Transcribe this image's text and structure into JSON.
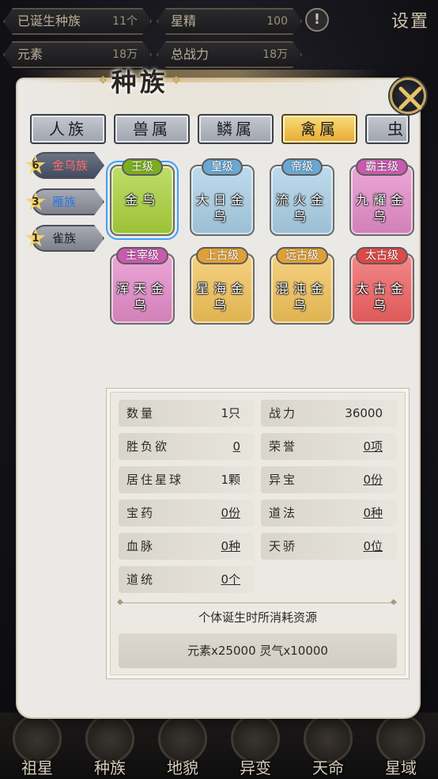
{
  "hud": {
    "born_species": {
      "label": "已诞生种族",
      "value": "11个"
    },
    "star_essence": {
      "label": "星精",
      "value": "100"
    },
    "elements": {
      "label": "元素",
      "value": "18万"
    },
    "total_power": {
      "label": "总战力",
      "value": "18万"
    },
    "settings_label": "设置"
  },
  "panel": {
    "title": "种族",
    "tabs": [
      {
        "label": "人族",
        "active": false
      },
      {
        "label": "兽属",
        "active": false
      },
      {
        "label": "鳞属",
        "active": false
      },
      {
        "label": "禽属",
        "active": true
      },
      {
        "label": "虫属",
        "active": false
      }
    ],
    "subtabs": [
      {
        "count": "6",
        "label": "金乌族",
        "active": true
      },
      {
        "count": "3",
        "label": "雁族",
        "active": false
      },
      {
        "count": "1",
        "label": "雀族",
        "active": false
      }
    ],
    "cards": [
      {
        "grade": "王级",
        "name": "金乌",
        "color": "#a9d23a",
        "badge_color": "#7cae22",
        "selected": true
      },
      {
        "grade": "皇级",
        "name": "大日金乌",
        "color": "#a9cfe6",
        "badge_color": "#6aa7d2",
        "selected": false
      },
      {
        "grade": "帝级",
        "name": "流火金乌",
        "color": "#a9cfe6",
        "badge_color": "#6aa7d2",
        "selected": false
      },
      {
        "grade": "霸主级",
        "name": "九耀金乌",
        "color": "#e48ac8",
        "badge_color": "#c95ab0",
        "selected": false
      },
      {
        "grade": "主宰级",
        "name": "浑天金乌",
        "color": "#e48ac8",
        "badge_color": "#c95ab0",
        "selected": false
      },
      {
        "grade": "上古级",
        "name": "星海金乌",
        "color": "#f2c257",
        "badge_color": "#e0a038",
        "selected": false
      },
      {
        "grade": "远古级",
        "name": "混沌金乌",
        "color": "#f2c257",
        "badge_color": "#e0a038",
        "selected": false
      },
      {
        "grade": "太古级",
        "name": "太古金乌",
        "color": "#f06060",
        "badge_color": "#e04848",
        "selected": false
      }
    ],
    "stats": {
      "quantity": {
        "label": "数量",
        "value": "1只"
      },
      "power": {
        "label": "战力",
        "value": "36000"
      },
      "ambition": {
        "label": "胜负欲",
        "value": "0"
      },
      "honor": {
        "label": "荣誉",
        "value": "0项"
      },
      "home_planet": {
        "label": "居住星球",
        "value": "1颗"
      },
      "treasure": {
        "label": "异宝",
        "value": "0份"
      },
      "medicine": {
        "label": "宝药",
        "value": "0份"
      },
      "dao_method": {
        "label": "道法",
        "value": "0种"
      },
      "bloodline": {
        "label": "血脉",
        "value": "0种"
      },
      "prodigy": {
        "label": "天骄",
        "value": "0位"
      },
      "orthodoxy": {
        "label": "道统",
        "value": "0个"
      }
    },
    "cost_title": "个体诞生时所消耗资源",
    "cost_value": "元素x25000  灵气x10000"
  },
  "bottom_nav": [
    {
      "label": "祖星"
    },
    {
      "label": "种族"
    },
    {
      "label": "地貌"
    },
    {
      "label": "异变"
    },
    {
      "label": "天命"
    },
    {
      "label": "星域"
    }
  ]
}
